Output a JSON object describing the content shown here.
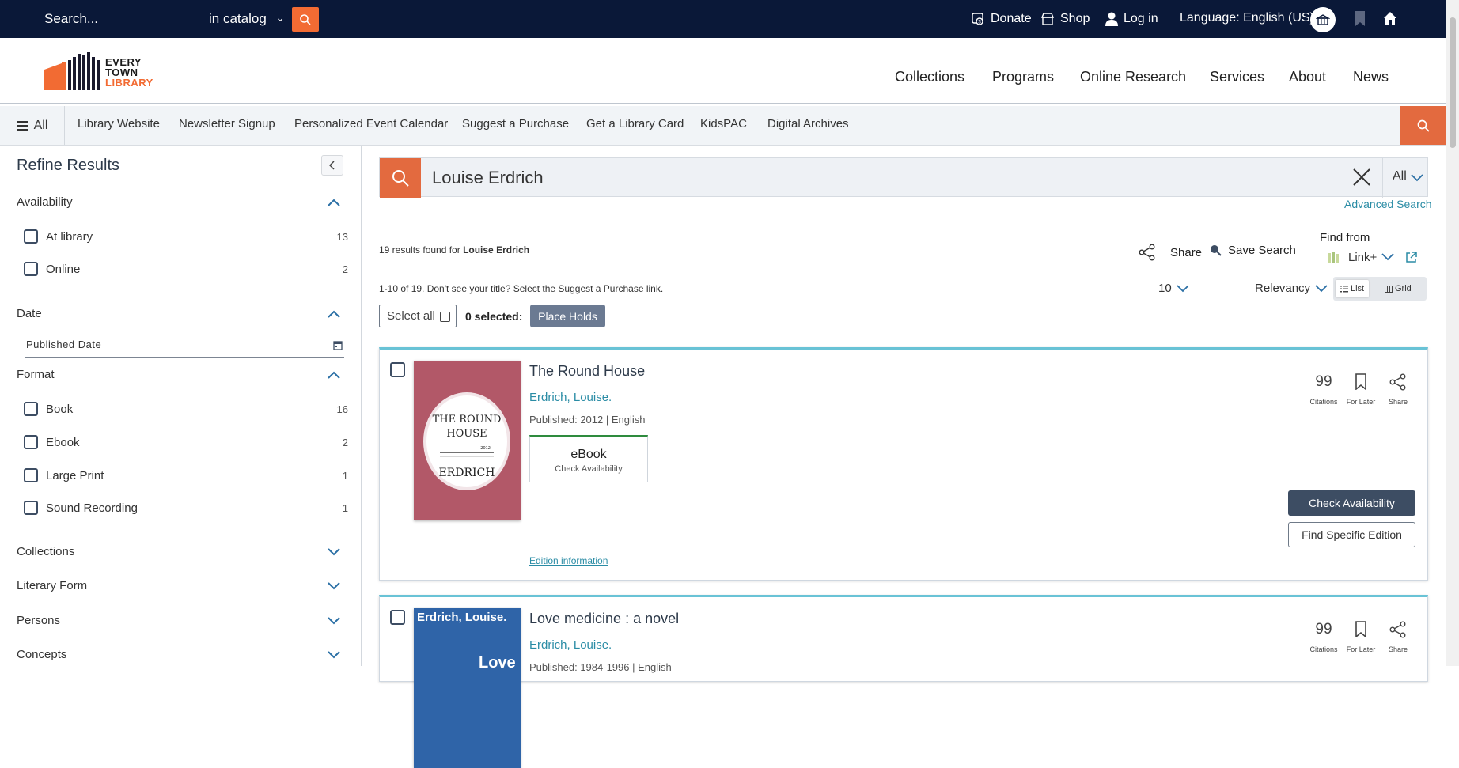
{
  "topbar": {
    "search_placeholder": "Search...",
    "scope": "in catalog",
    "links": [
      "Donate",
      "Shop",
      "Log in"
    ],
    "language": "Language: English (US)"
  },
  "logo": {
    "line1": "EVERY",
    "line2": "TOWN",
    "line3": "LIBRARY"
  },
  "main_nav": [
    "Collections",
    "Programs",
    "Online Research",
    "Services",
    "About",
    "News"
  ],
  "sub_nav": {
    "all": "All",
    "items": [
      "Library Website",
      "Newsletter Signup",
      "Personalized Event Calendar",
      "Suggest a Purchase",
      "Get a Library Card",
      "KidsPAC",
      "Digital Archives"
    ]
  },
  "sidebar": {
    "title": "Refine Results",
    "availability": {
      "heading": "Availability",
      "options": [
        {
          "label": "At library",
          "count": "13"
        },
        {
          "label": "Online",
          "count": "2"
        }
      ]
    },
    "date": {
      "heading": "Date",
      "placeholder": "Published Date"
    },
    "format": {
      "heading": "Format",
      "options": [
        {
          "label": "Book",
          "count": "16"
        },
        {
          "label": "Ebook",
          "count": "2"
        },
        {
          "label": "Large Print",
          "count": "1"
        },
        {
          "label": "Sound Recording",
          "count": "1"
        }
      ]
    },
    "collapsed": [
      "Collections",
      "Literary Form",
      "Persons",
      "Concepts"
    ]
  },
  "search": {
    "query": "Louise Erdrich",
    "scope": "All",
    "advanced": "Advanced Search"
  },
  "results": {
    "count_prefix": "19 results found for ",
    "count_query": "Louise Erdrich",
    "share": "Share",
    "save": "Save Search",
    "find_from": "Find from",
    "link_plus": "Link+",
    "message": "1-10 of 19. Don't see your title? Select the Suggest a Purchase link.",
    "per_page": "10",
    "sort": "Relevancy",
    "view_list": "List",
    "view_grid": "Grid",
    "select_all": "Select all",
    "selected": "0 selected:",
    "place_holds": "Place Holds"
  },
  "items": [
    {
      "title": "The Round House",
      "author": "Erdrich, Louise.",
      "published": "Published: 2012 | English",
      "format": "eBook",
      "format_sub": "Check Availability",
      "citations_num": "99",
      "citations": "Citations",
      "for_later": "For Later",
      "share": "Share",
      "check": "Check Availability",
      "find_edition": "Find Specific Edition",
      "edition_info": "Edition information",
      "cover_title1": "THE ROUND",
      "cover_title2": "HOUSE",
      "cover_author": "ERDRICH",
      "cover_year": "2012",
      "cover_color": "#b25868"
    },
    {
      "title": "Love medicine : a novel",
      "author": "Erdrich, Louise.",
      "published": "Published: 1984-1996 | English",
      "citations_num": "99",
      "citations": "Citations",
      "for_later": "For Later",
      "share": "Share",
      "cover_author": "Erdrich, Louise.",
      "cover_title": "Love",
      "cover_color": "#2f64a8"
    }
  ],
  "colors": {
    "navy": "#0a1838",
    "orange": "#f26b33",
    "teal": "#2a8ca5",
    "slate": "#3d4d63"
  }
}
